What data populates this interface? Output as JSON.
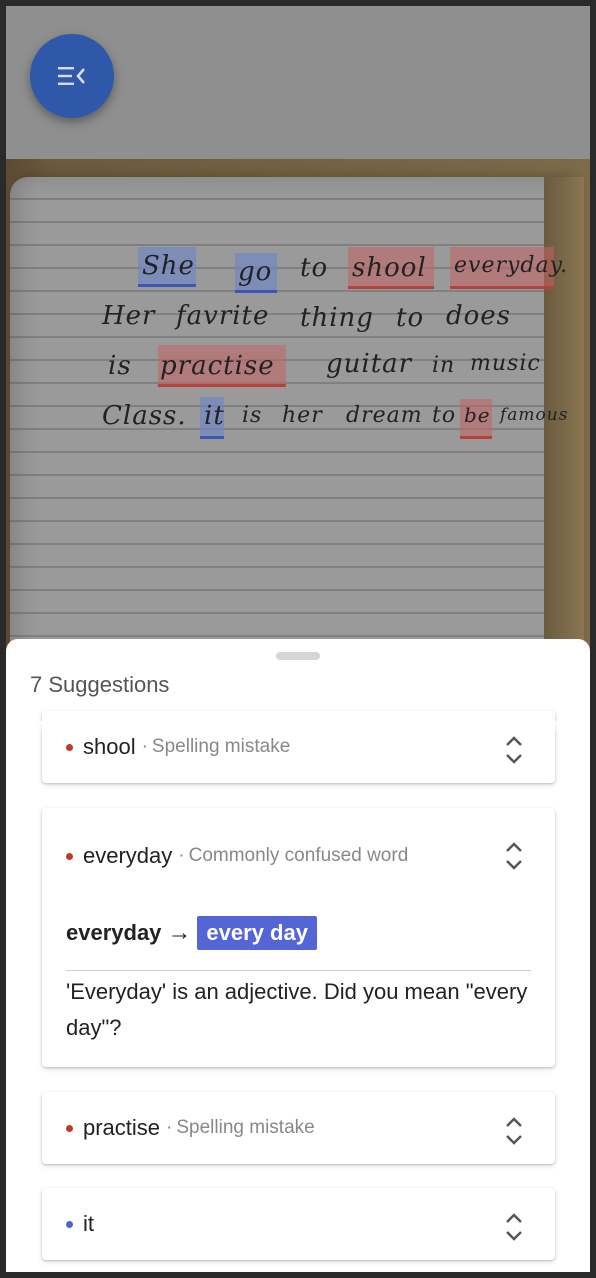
{
  "toolbar": {
    "menu_icon": "menu-collapse-icon",
    "fab_color": "#2f59a8"
  },
  "photo": {
    "lines": [
      [
        {
          "t": "She",
          "hl": "blue"
        },
        {
          "t": "go",
          "hl": "blue"
        },
        {
          "t": "to",
          "hl": ""
        },
        {
          "t": "shool",
          "hl": "red"
        },
        {
          "t": "everyday.",
          "hl": "red"
        }
      ],
      [
        {
          "t": "Her",
          "hl": ""
        },
        {
          "t": "favrite",
          "hl": ""
        },
        {
          "t": "thing",
          "hl": ""
        },
        {
          "t": "to",
          "hl": ""
        },
        {
          "t": "does",
          "hl": ""
        }
      ],
      [
        {
          "t": "is",
          "hl": ""
        },
        {
          "t": "practise",
          "hl": "red"
        },
        {
          "t": "guitar",
          "hl": ""
        },
        {
          "t": "in",
          "hl": ""
        },
        {
          "t": "music",
          "hl": ""
        }
      ],
      [
        {
          "t": "Class.",
          "hl": ""
        },
        {
          "t": "it",
          "hl": "blue"
        },
        {
          "t": "is",
          "hl": ""
        },
        {
          "t": "her",
          "hl": ""
        },
        {
          "t": "dream",
          "hl": ""
        },
        {
          "t": "to",
          "hl": ""
        },
        {
          "t": "be",
          "hl": "red"
        },
        {
          "t": "famous",
          "hl": ""
        }
      ]
    ]
  },
  "sheet": {
    "title": "7 Suggestions",
    "cards": [
      {
        "word": "shool",
        "separator": "·",
        "category": "Spelling mistake",
        "severity": "red",
        "expanded": false
      },
      {
        "word": "everyday",
        "separator": "·",
        "category": "Commonly confused word",
        "severity": "red",
        "expanded": true,
        "from": "everyday",
        "arrow": "→",
        "to": "every day",
        "explanation": "'Everyday' is an adjective. Did you mean \"every day\"?"
      },
      {
        "word": "practise",
        "separator": "·",
        "category": "Spelling mistake",
        "severity": "red",
        "expanded": false
      },
      {
        "word": "it",
        "separator": "",
        "category": "",
        "severity": "blue",
        "expanded": false
      }
    ]
  },
  "colors": {
    "error": "#c0392b",
    "suggestion_blue": "#4b63cf",
    "replacement_bg": "#5466d6"
  }
}
